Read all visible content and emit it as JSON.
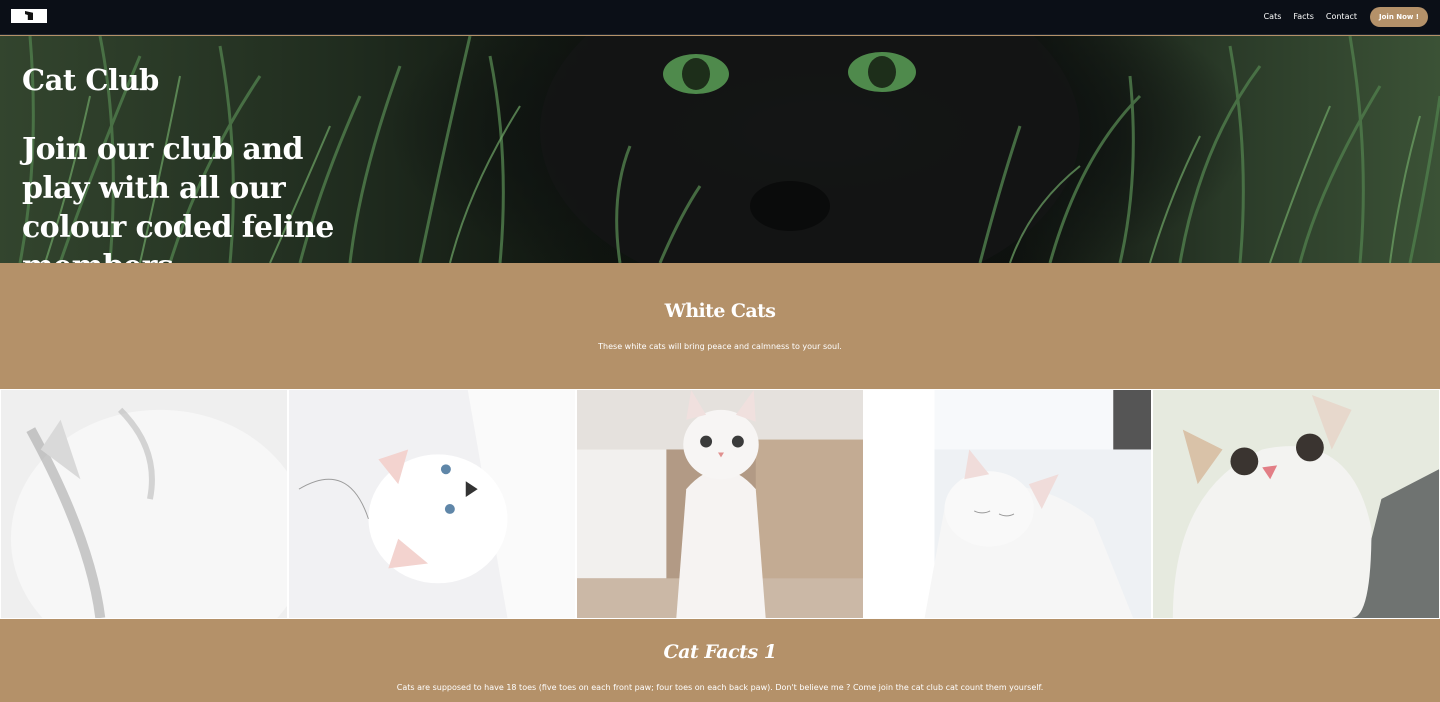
{
  "nav": {
    "links": [
      "Cats",
      "Facts",
      "Contact"
    ],
    "cta_label": "Join Now !"
  },
  "hero": {
    "title": "Cat Club",
    "tagline": "Join our club and play with all our colour coded feline members."
  },
  "white_cats": {
    "title": "White Cats",
    "description": "These white cats will bring peace and calmness to your soul."
  },
  "gallery": {
    "photo_count": 5
  },
  "facts": {
    "title": "Cat Facts 1",
    "text": "Cats are supposed to have 18 toes (five toes on each front paw; four toes on each back paw). Don't believe me ? Come join the cat club cat count them yourself."
  },
  "colors": {
    "accent": "#b49169",
    "navbar": "#0b0f17",
    "text": "#ffffff"
  }
}
